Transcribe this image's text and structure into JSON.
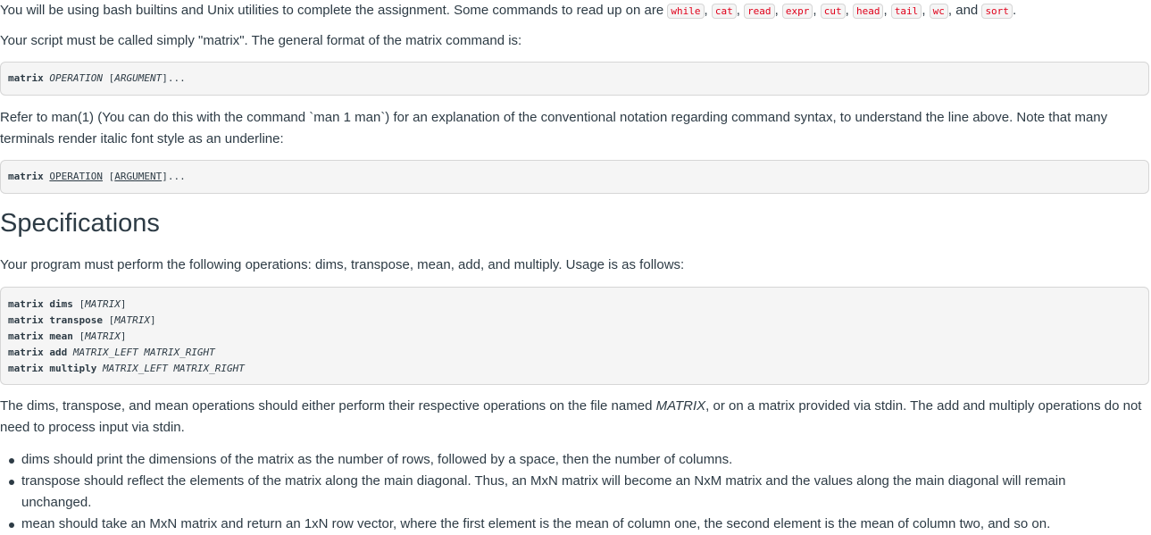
{
  "intro": {
    "text_before": "You will be using bash builtins and Unix utilities to complete the assignment. Some commands to read up on are ",
    "commands": [
      "while",
      "cat",
      "read",
      "expr",
      "cut",
      "head",
      "tail",
      "wc",
      "sort"
    ],
    "sep": ", ",
    "and_word": ", and ",
    "end": "."
  },
  "format_intro": "Your script must be called simply \"matrix\". The general format of the matrix command is:",
  "usage1": {
    "cmd": "matrix",
    "operation": "OPERATION",
    "arg": "ARGUMENT",
    "open": " [",
    "close": "]..."
  },
  "man_paragraph": "Refer to man(1) (You can do this with the command `man 1 man`) for an explanation of the conventional notation regarding command syntax, to understand the line above. Note that many terminals render italic font style as an underline:",
  "usage2": {
    "cmd": "matrix",
    "operation": "OPERATION",
    "arg": "ARGUMENT",
    "open": " [",
    "close": "]..."
  },
  "heading": "Specifications",
  "ops_paragraph": "Your program must perform the following operations: dims, transpose, mean, add, and multiply. Usage is as follows:",
  "usage_lines": [
    {
      "cmd": "matrix dims",
      "args": "[MATRIX]",
      "bracket": true,
      "inner": "MATRIX"
    },
    {
      "cmd": "matrix transpose",
      "args": "[MATRIX]",
      "bracket": true,
      "inner": "MATRIX"
    },
    {
      "cmd": "matrix mean",
      "args": "[MATRIX]",
      "bracket": true,
      "inner": "MATRIX"
    },
    {
      "cmd": "matrix add",
      "args": "MATRIX_LEFT MATRIX_RIGHT",
      "bracket": false,
      "inner": "MATRIX_LEFT MATRIX_RIGHT"
    },
    {
      "cmd": "matrix multiply",
      "args": "MATRIX_LEFT MATRIX_RIGHT",
      "bracket": false,
      "inner": "MATRIX_LEFT MATRIX_RIGHT"
    }
  ],
  "stdin_paragraph": {
    "before": "The dims, transpose, and mean operations should either perform their respective operations on the file named ",
    "italic": "MATRIX",
    "after": ", or on a matrix provided via stdin. The add and multiply operations do not need to process input via stdin."
  },
  "bullets": [
    "dims should print the dimensions of the matrix as the number of rows, followed by a space, then the number of columns.",
    "transpose should reflect the elements of the matrix along the main diagonal. Thus, an MxN matrix will become an NxM matrix and the values along the main diagonal will remain unchanged.",
    "mean should take an MxN matrix and return an 1xN row vector, where the first element is the mean of column one, the second element is the mean of column two, and so on."
  ]
}
